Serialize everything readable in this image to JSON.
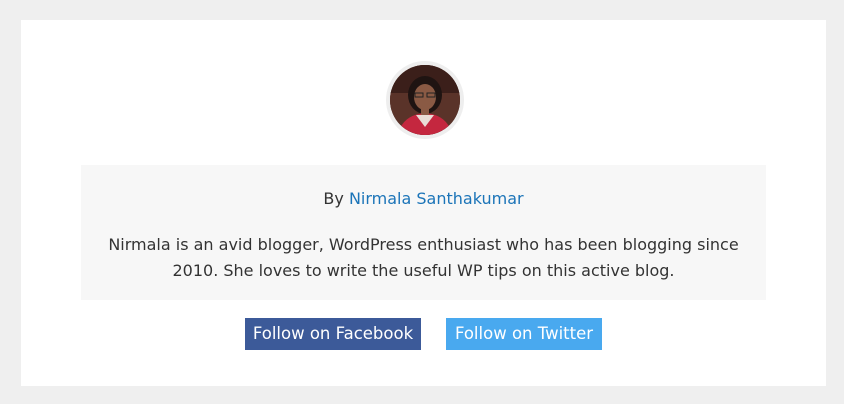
{
  "author": {
    "by_prefix": "By",
    "name": "Nirmala Santhakumar",
    "bio_lines": [
      "Nirmala is an avid blogger, WordPress enthusiast who has been blogging since",
      "2010. She loves to write the useful WP tips on this active blog."
    ]
  },
  "buttons": {
    "facebook_label": "Follow on Facebook",
    "twitter_label": "Follow on Twitter"
  },
  "colors": {
    "page_background": "#efefef",
    "link": "#1b74b8",
    "facebook": "#3c5a99",
    "twitter": "#49a9ef"
  }
}
